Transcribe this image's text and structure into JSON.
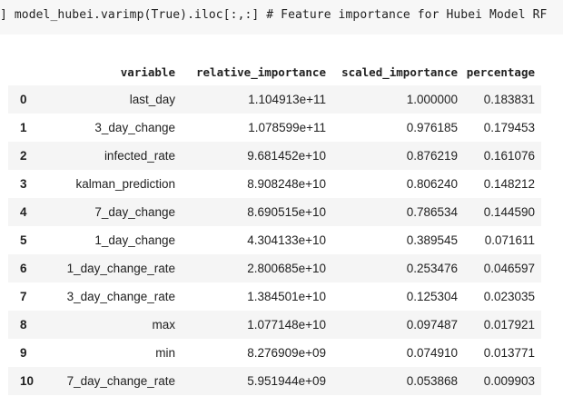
{
  "code_cell": {
    "source": "] model_hubei.varimp(True).iloc[:,:] # Feature importance for Hubei Model RF"
  },
  "table": {
    "columns": [
      "",
      "variable",
      "relative_importance",
      "scaled_importance",
      "percentage"
    ],
    "rows": [
      {
        "index": "0",
        "variable": "last_day",
        "relative_importance": "1.104913e+11",
        "scaled_importance": "1.000000",
        "percentage": "0.183831"
      },
      {
        "index": "1",
        "variable": "3_day_change",
        "relative_importance": "1.078599e+11",
        "scaled_importance": "0.976185",
        "percentage": "0.179453"
      },
      {
        "index": "2",
        "variable": "infected_rate",
        "relative_importance": "9.681452e+10",
        "scaled_importance": "0.876219",
        "percentage": "0.161076"
      },
      {
        "index": "3",
        "variable": "kalman_prediction",
        "relative_importance": "8.908248e+10",
        "scaled_importance": "0.806240",
        "percentage": "0.148212"
      },
      {
        "index": "4",
        "variable": "7_day_change",
        "relative_importance": "8.690515e+10",
        "scaled_importance": "0.786534",
        "percentage": "0.144590"
      },
      {
        "index": "5",
        "variable": "1_day_change",
        "relative_importance": "4.304133e+10",
        "scaled_importance": "0.389545",
        "percentage": "0.071611"
      },
      {
        "index": "6",
        "variable": "1_day_change_rate",
        "relative_importance": "2.800685e+10",
        "scaled_importance": "0.253476",
        "percentage": "0.046597"
      },
      {
        "index": "7",
        "variable": "3_day_change_rate",
        "relative_importance": "1.384501e+10",
        "scaled_importance": "0.125304",
        "percentage": "0.023035"
      },
      {
        "index": "8",
        "variable": "max",
        "relative_importance": "1.077148e+10",
        "scaled_importance": "0.097487",
        "percentage": "0.017921"
      },
      {
        "index": "9",
        "variable": "min",
        "relative_importance": "8.276909e+09",
        "scaled_importance": "0.074910",
        "percentage": "0.013771"
      },
      {
        "index": "10",
        "variable": "7_day_change_rate",
        "relative_importance": "5.951944e+09",
        "scaled_importance": "0.053868",
        "percentage": "0.009903"
      }
    ]
  },
  "colors": {
    "code_background": "#f7f7f7",
    "row_stripe": "#f5f5f5",
    "text": "#212121"
  }
}
